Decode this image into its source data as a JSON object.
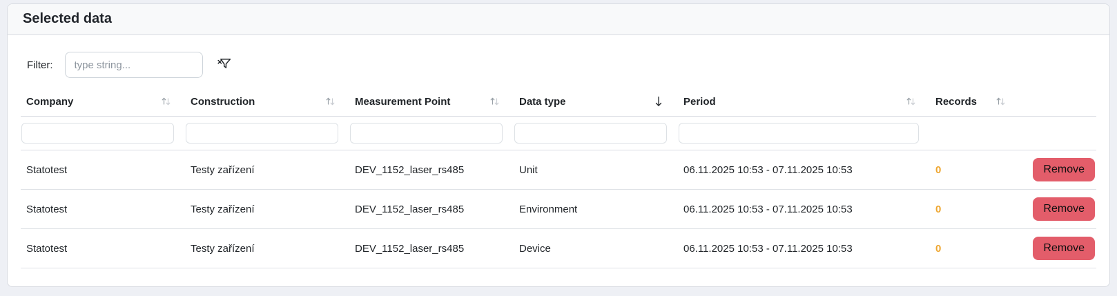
{
  "card": {
    "title": "Selected data"
  },
  "filter": {
    "label": "Filter:",
    "placeholder": "type string...",
    "clear_icon": "filter-clear-icon"
  },
  "table": {
    "columns": [
      {
        "label": "Company",
        "sort": "none",
        "has_filter": true
      },
      {
        "label": "Construction",
        "sort": "none",
        "has_filter": true
      },
      {
        "label": "Measurement Point",
        "sort": "none",
        "has_filter": true
      },
      {
        "label": "Data type",
        "sort": "desc",
        "has_filter": true
      },
      {
        "label": "Period",
        "sort": "none",
        "has_filter": true
      },
      {
        "label": "Records",
        "sort": "none",
        "has_filter": false
      }
    ],
    "rows": [
      {
        "company": "Statotest",
        "construction": "Testy zařízení",
        "measurement_point": "DEV_1152_laser_rs485",
        "data_type": "Unit",
        "period": "06.11.2025 10:53 - 07.11.2025 10:53",
        "records": "0",
        "action": "Remove"
      },
      {
        "company": "Statotest",
        "construction": "Testy zařízení",
        "measurement_point": "DEV_1152_laser_rs485",
        "data_type": "Environment",
        "period": "06.11.2025 10:53 - 07.11.2025 10:53",
        "records": "0",
        "action": "Remove"
      },
      {
        "company": "Statotest",
        "construction": "Testy zařízení",
        "measurement_point": "DEV_1152_laser_rs485",
        "data_type": "Device",
        "period": "06.11.2025 10:53 - 07.11.2025 10:53",
        "records": "0",
        "action": "Remove"
      }
    ]
  },
  "colors": {
    "page_background": "#eef0f5",
    "card_header_background": "#f8f9fa",
    "border": "#d9dce2",
    "records_value": "#eea62f",
    "remove_button": "#e35d6a",
    "active_sort_arrow": "#212529",
    "inactive_sort_arrow": "#b3b9c0"
  }
}
